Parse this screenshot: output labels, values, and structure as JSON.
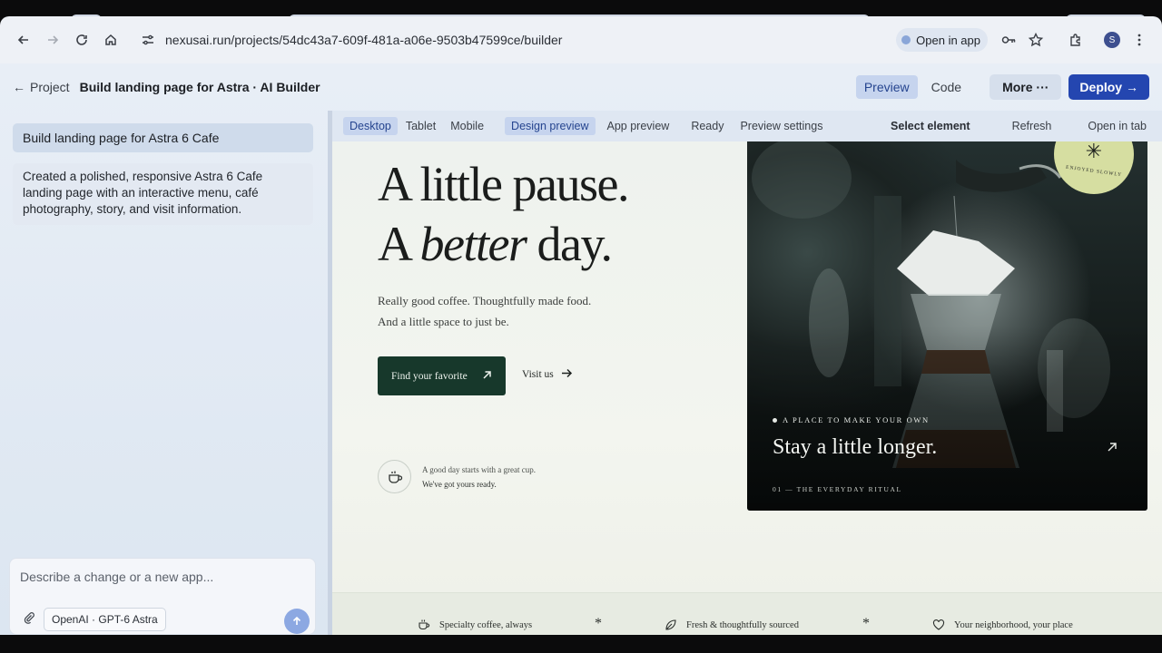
{
  "browser": {
    "url": "nexusai.run/projects/54dc43a7-609f-481a-a06e-9503b47599ce/builder",
    "open_in_app": "Open in app",
    "profile_initial": "S"
  },
  "header": {
    "back_label": "Project",
    "project_title": "Build landing page for Astra · AI Builder",
    "view_tabs": [
      "Preview",
      "Code"
    ],
    "more_label": "More ···",
    "deploy_label": "Deploy →"
  },
  "chat": {
    "user_message": "Build landing page for Astra 6 Cafe",
    "ai_message": "Created a polished, responsive Astra 6 Cafe landing page with an interactive menu, café photography, story, and visit information.",
    "input_placeholder": "Describe a change or a new app...",
    "model_label": "OpenAI · GPT-6 Astra"
  },
  "preview_toolbar": {
    "devices": [
      "Desktop",
      "Tablet",
      "Mobile"
    ],
    "modes": [
      "Design preview",
      "App preview",
      "Ready",
      "Preview settings"
    ],
    "actions": [
      "Select element",
      "Refresh",
      "Open in tab"
    ]
  },
  "site": {
    "hero_line1": "A little pause.",
    "hero_line2_a": "A",
    "hero_line2_em": "better",
    "hero_line2_b": "day.",
    "sub_line1": "Really good coffee. Thoughtfully made food.",
    "sub_line2": "And a little space to just be.",
    "cta_label": "Find your favorite",
    "visit_label": "Visit us",
    "cup_line1": "A good day starts with a great cup.",
    "cup_line2": "We've got yours ready.",
    "photo": {
      "sticker_text": "ENJOYED SLOWLY",
      "eyebrow": "A PLACE TO MAKE YOUR OWN",
      "title": "Stay a little longer.",
      "meta": "01 — THE EVERYDAY RITUAL"
    },
    "features": [
      "Specialty coffee, always",
      "Fresh & thoughtfully sourced",
      "Your neighborhood, your place"
    ]
  },
  "colors": {
    "accent": "#2446b0",
    "cta_green": "#17382b",
    "sticker": "#d6dea1"
  }
}
